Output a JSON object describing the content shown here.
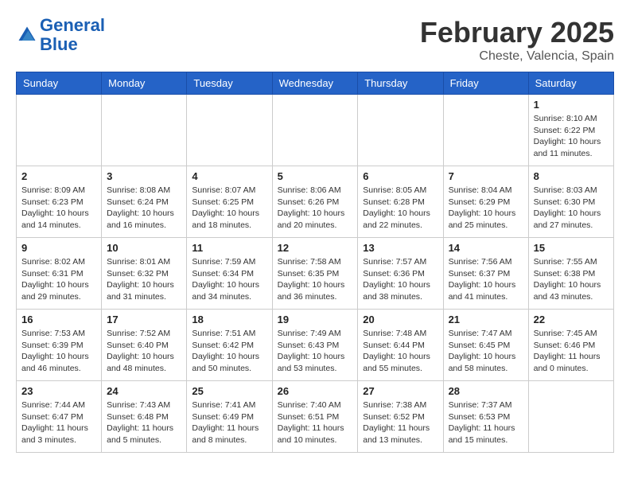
{
  "logo": {
    "line1": "General",
    "line2": "Blue"
  },
  "title": "February 2025",
  "location": "Cheste, Valencia, Spain",
  "days_of_week": [
    "Sunday",
    "Monday",
    "Tuesday",
    "Wednesday",
    "Thursday",
    "Friday",
    "Saturday"
  ],
  "weeks": [
    [
      {
        "day": "",
        "text": ""
      },
      {
        "day": "",
        "text": ""
      },
      {
        "day": "",
        "text": ""
      },
      {
        "day": "",
        "text": ""
      },
      {
        "day": "",
        "text": ""
      },
      {
        "day": "",
        "text": ""
      },
      {
        "day": "1",
        "text": "Sunrise: 8:10 AM\nSunset: 6:22 PM\nDaylight: 10 hours\nand 11 minutes."
      }
    ],
    [
      {
        "day": "2",
        "text": "Sunrise: 8:09 AM\nSunset: 6:23 PM\nDaylight: 10 hours\nand 14 minutes."
      },
      {
        "day": "3",
        "text": "Sunrise: 8:08 AM\nSunset: 6:24 PM\nDaylight: 10 hours\nand 16 minutes."
      },
      {
        "day": "4",
        "text": "Sunrise: 8:07 AM\nSunset: 6:25 PM\nDaylight: 10 hours\nand 18 minutes."
      },
      {
        "day": "5",
        "text": "Sunrise: 8:06 AM\nSunset: 6:26 PM\nDaylight: 10 hours\nand 20 minutes."
      },
      {
        "day": "6",
        "text": "Sunrise: 8:05 AM\nSunset: 6:28 PM\nDaylight: 10 hours\nand 22 minutes."
      },
      {
        "day": "7",
        "text": "Sunrise: 8:04 AM\nSunset: 6:29 PM\nDaylight: 10 hours\nand 25 minutes."
      },
      {
        "day": "8",
        "text": "Sunrise: 8:03 AM\nSunset: 6:30 PM\nDaylight: 10 hours\nand 27 minutes."
      }
    ],
    [
      {
        "day": "9",
        "text": "Sunrise: 8:02 AM\nSunset: 6:31 PM\nDaylight: 10 hours\nand 29 minutes."
      },
      {
        "day": "10",
        "text": "Sunrise: 8:01 AM\nSunset: 6:32 PM\nDaylight: 10 hours\nand 31 minutes."
      },
      {
        "day": "11",
        "text": "Sunrise: 7:59 AM\nSunset: 6:34 PM\nDaylight: 10 hours\nand 34 minutes."
      },
      {
        "day": "12",
        "text": "Sunrise: 7:58 AM\nSunset: 6:35 PM\nDaylight: 10 hours\nand 36 minutes."
      },
      {
        "day": "13",
        "text": "Sunrise: 7:57 AM\nSunset: 6:36 PM\nDaylight: 10 hours\nand 38 minutes."
      },
      {
        "day": "14",
        "text": "Sunrise: 7:56 AM\nSunset: 6:37 PM\nDaylight: 10 hours\nand 41 minutes."
      },
      {
        "day": "15",
        "text": "Sunrise: 7:55 AM\nSunset: 6:38 PM\nDaylight: 10 hours\nand 43 minutes."
      }
    ],
    [
      {
        "day": "16",
        "text": "Sunrise: 7:53 AM\nSunset: 6:39 PM\nDaylight: 10 hours\nand 46 minutes."
      },
      {
        "day": "17",
        "text": "Sunrise: 7:52 AM\nSunset: 6:40 PM\nDaylight: 10 hours\nand 48 minutes."
      },
      {
        "day": "18",
        "text": "Sunrise: 7:51 AM\nSunset: 6:42 PM\nDaylight: 10 hours\nand 50 minutes."
      },
      {
        "day": "19",
        "text": "Sunrise: 7:49 AM\nSunset: 6:43 PM\nDaylight: 10 hours\nand 53 minutes."
      },
      {
        "day": "20",
        "text": "Sunrise: 7:48 AM\nSunset: 6:44 PM\nDaylight: 10 hours\nand 55 minutes."
      },
      {
        "day": "21",
        "text": "Sunrise: 7:47 AM\nSunset: 6:45 PM\nDaylight: 10 hours\nand 58 minutes."
      },
      {
        "day": "22",
        "text": "Sunrise: 7:45 AM\nSunset: 6:46 PM\nDaylight: 11 hours\nand 0 minutes."
      }
    ],
    [
      {
        "day": "23",
        "text": "Sunrise: 7:44 AM\nSunset: 6:47 PM\nDaylight: 11 hours\nand 3 minutes."
      },
      {
        "day": "24",
        "text": "Sunrise: 7:43 AM\nSunset: 6:48 PM\nDaylight: 11 hours\nand 5 minutes."
      },
      {
        "day": "25",
        "text": "Sunrise: 7:41 AM\nSunset: 6:49 PM\nDaylight: 11 hours\nand 8 minutes."
      },
      {
        "day": "26",
        "text": "Sunrise: 7:40 AM\nSunset: 6:51 PM\nDaylight: 11 hours\nand 10 minutes."
      },
      {
        "day": "27",
        "text": "Sunrise: 7:38 AM\nSunset: 6:52 PM\nDaylight: 11 hours\nand 13 minutes."
      },
      {
        "day": "28",
        "text": "Sunrise: 7:37 AM\nSunset: 6:53 PM\nDaylight: 11 hours\nand 15 minutes."
      },
      {
        "day": "",
        "text": ""
      }
    ]
  ]
}
